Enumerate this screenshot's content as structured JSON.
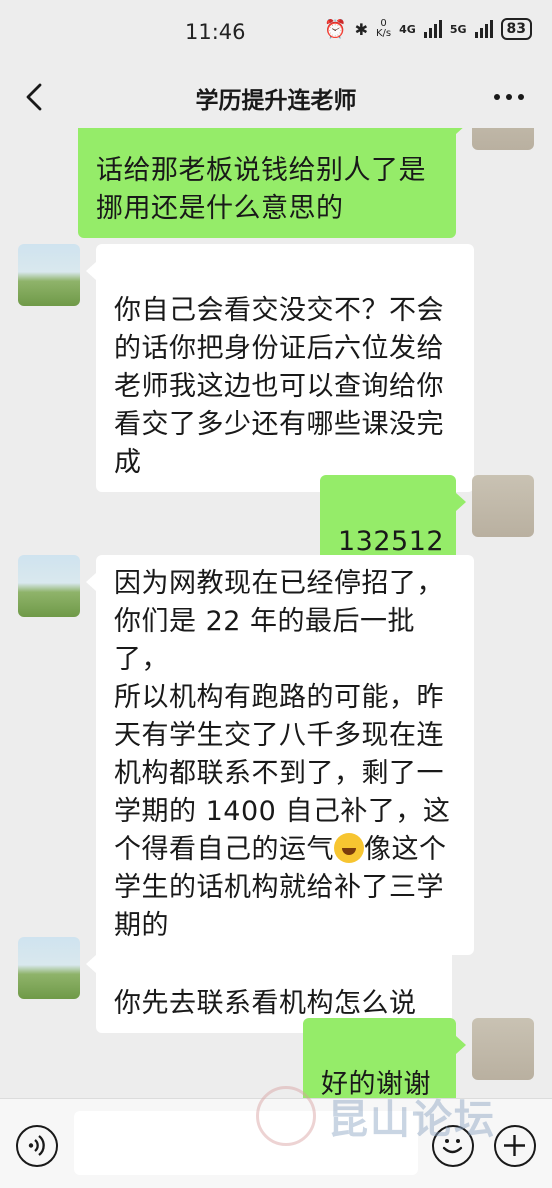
{
  "status_bar": {
    "time": "11:46",
    "net_speed_value": "0",
    "net_speed_unit": "K/s",
    "network_1": "4G",
    "network_2": "5G",
    "battery": "83"
  },
  "header": {
    "title": "学历提升连老师"
  },
  "messages": [
    {
      "from": "me",
      "text": "话给那老板说钱给别人了是\n挪用还是什么意思的"
    },
    {
      "from": "teacher",
      "text": "你自己会看交没交不？不会\n的话你把身份证后六位发给\n老师我这边也可以查询给你\n看交了多少还有哪些课没完\n成"
    },
    {
      "from": "me",
      "text": "132512"
    },
    {
      "from": "teacher",
      "text_before_emoji": "因为网教现在已经停招了，\n你们是 22 年的最后一批了，\n所以机构有跑路的可能，昨\n天有学生交了八千多现在连\n机构都联系不到了，剩了一\n学期的 1400 自己补了，这\n个得看自己的运气",
      "emoji": "laughing-crying-emoji",
      "text_after_emoji": "像这个\n学生的话机构就给补了三学\n期的"
    },
    {
      "from": "teacher",
      "text": "你先去联系看机构怎么说"
    },
    {
      "from": "me",
      "text": "好的谢谢"
    }
  ],
  "input_bar": {
    "placeholder": "",
    "watermark": "昆山论坛"
  },
  "colors": {
    "background": "#ededed",
    "outgoing_bubble": "#95ec69",
    "incoming_bubble": "#ffffff"
  }
}
